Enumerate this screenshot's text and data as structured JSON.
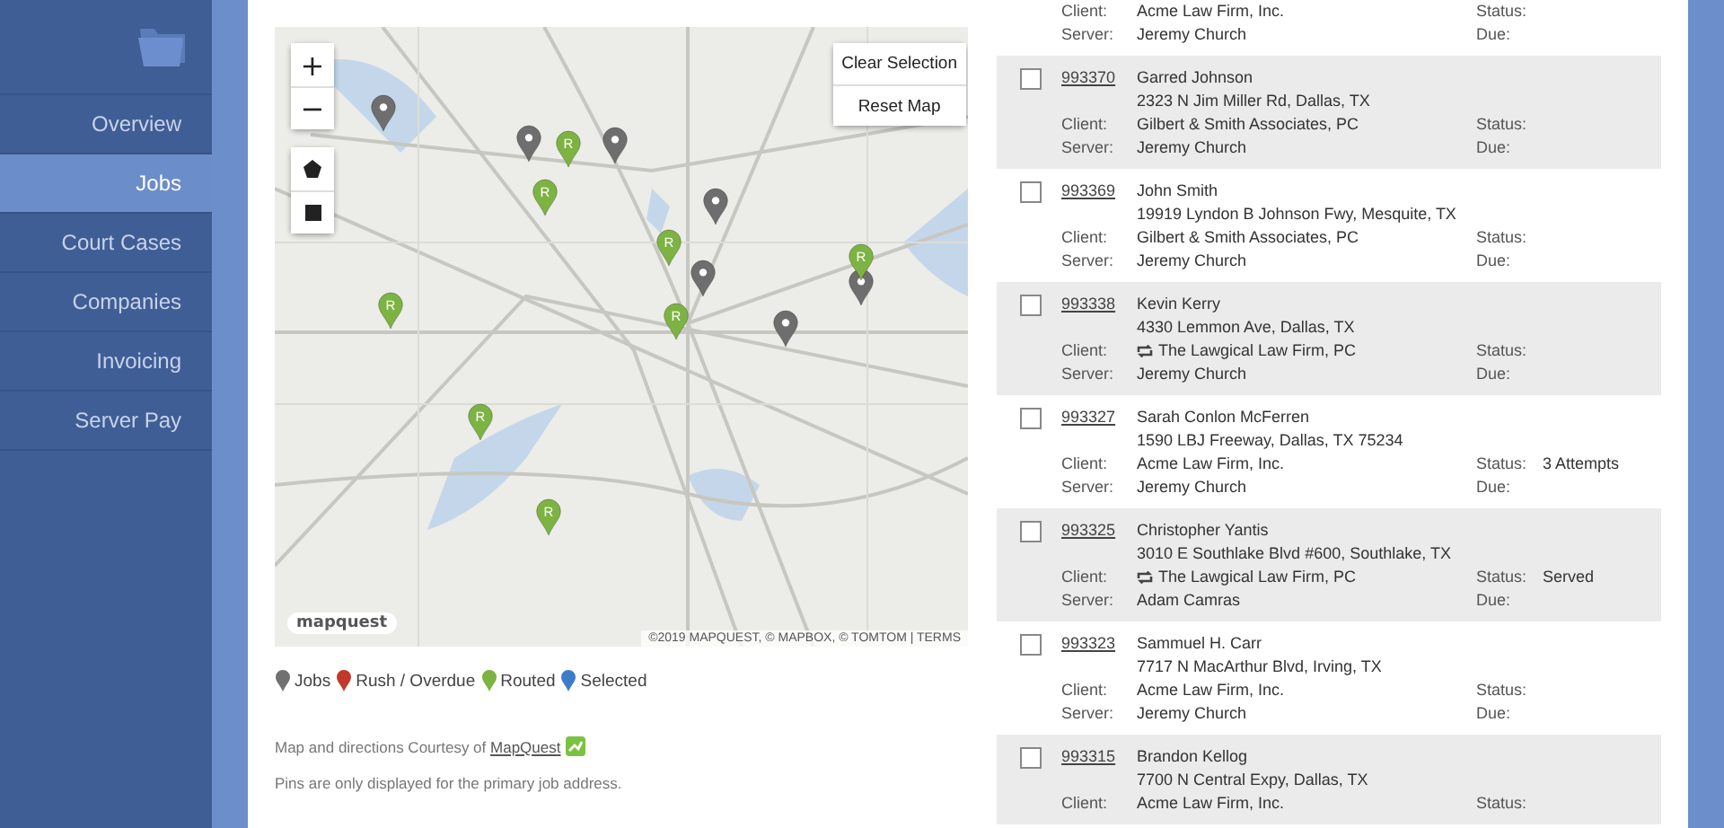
{
  "sidebar": {
    "items": [
      {
        "label": "Overview",
        "selected": false
      },
      {
        "label": "Jobs",
        "selected": true
      },
      {
        "label": "Court Cases",
        "selected": false
      },
      {
        "label": "Companies",
        "selected": false
      },
      {
        "label": "Invoicing",
        "selected": false
      },
      {
        "label": "Server Pay",
        "selected": false
      }
    ]
  },
  "map": {
    "zoom_in": "+",
    "zoom_out": "−",
    "buttons": [
      "Clear Selection",
      "Reset Map"
    ],
    "logo": "mapquest",
    "attribution": "©2019 MAPQUEST, © MAPBOX, © TOMTOM | TERMS",
    "pins": [
      {
        "kind": "job"
      },
      {
        "kind": "job"
      },
      {
        "kind": "job"
      },
      {
        "kind": "job"
      },
      {
        "kind": "job"
      },
      {
        "kind": "job"
      },
      {
        "kind": "job"
      },
      {
        "kind": "routed",
        "label": "R"
      },
      {
        "kind": "routed",
        "label": "R"
      },
      {
        "kind": "routed",
        "label": "R"
      },
      {
        "kind": "routed",
        "label": "R"
      },
      {
        "kind": "routed",
        "label": "R"
      },
      {
        "kind": "routed",
        "label": "R"
      },
      {
        "kind": "routed",
        "label": "R"
      },
      {
        "kind": "routed",
        "label": "R"
      }
    ]
  },
  "legend": [
    {
      "label": "Jobs",
      "color": "#707070"
    },
    {
      "label": "Rush / Overdue",
      "color": "#c0392b"
    },
    {
      "label": "Routed",
      "color": "#7cb342"
    },
    {
      "label": "Selected",
      "color": "#3d7cc9"
    }
  ],
  "courtesy": {
    "text": "Map and directions Courtesy of ",
    "link": "MapQuest"
  },
  "note": "Pins are only displayed for the primary job address.",
  "jobs": [
    {
      "client_label": "Client:",
      "client": "Acme Law Firm, Inc.",
      "client_linked": false,
      "status_label": "Status:",
      "server_label": "Server:",
      "server": "Jeremy Church",
      "due_label": "Due:"
    },
    {
      "id": "993370",
      "name": "Garred Johnson",
      "address": "2323 N Jim Miller Rd, Dallas, TX",
      "client_label": "Client:",
      "client": "Gilbert & Smith Associates, PC",
      "client_linked": false,
      "status_label": "Status:",
      "server_label": "Server:",
      "server": "Jeremy Church",
      "due_label": "Due:",
      "checked": false
    },
    {
      "id": "993369",
      "name": "John Smith",
      "address": "19919 Lyndon B Johnson Fwy, Mesquite, TX",
      "client_label": "Client:",
      "client": "Gilbert & Smith Associates, PC",
      "client_linked": false,
      "status_label": "Status:",
      "server_label": "Server:",
      "server": "Jeremy Church",
      "due_label": "Due:",
      "checked": false
    },
    {
      "id": "993338",
      "name": "Kevin Kerry",
      "address": "4330 Lemmon Ave, Dallas, TX",
      "client_label": "Client:",
      "client": "The Lawgical Law Firm, PC",
      "client_linked": true,
      "status_label": "Status:",
      "server_label": "Server:",
      "server": "Jeremy Church",
      "due_label": "Due:",
      "checked": false
    },
    {
      "id": "993327",
      "name": "Sarah Conlon McFerren",
      "address": "1590 LBJ Freeway, Dallas, TX 75234",
      "client_label": "Client:",
      "client": "Acme Law Firm, Inc.",
      "client_linked": false,
      "status_label": "Status:",
      "status": "3 Attempts",
      "server_label": "Server:",
      "server": "Jeremy Church",
      "due_label": "Due:",
      "checked": false
    },
    {
      "id": "993325",
      "name": "Christopher Yantis",
      "address": "3010 E Southlake Blvd #600, Southlake, TX",
      "client_label": "Client:",
      "client": "The Lawgical Law Firm, PC",
      "client_linked": true,
      "status_label": "Status:",
      "status": "Served",
      "server_label": "Server:",
      "server": "Adam Camras",
      "due_label": "Due:",
      "checked": false
    },
    {
      "id": "993323",
      "name": "Sammuel H. Carr",
      "address": "7717 N MacArthur Blvd, Irving, TX",
      "client_label": "Client:",
      "client": "Acme Law Firm, Inc.",
      "client_linked": false,
      "status_label": "Status:",
      "server_label": "Server:",
      "server": "Jeremy Church",
      "due_label": "Due:",
      "checked": false
    },
    {
      "id": "993315",
      "name": "Brandon Kellog",
      "address": "7700 N Central Expy, Dallas, TX",
      "client_label": "Client:",
      "client": "Acme Law Firm, Inc.",
      "client_linked": false,
      "status_label": "Status:",
      "checked": false
    }
  ]
}
